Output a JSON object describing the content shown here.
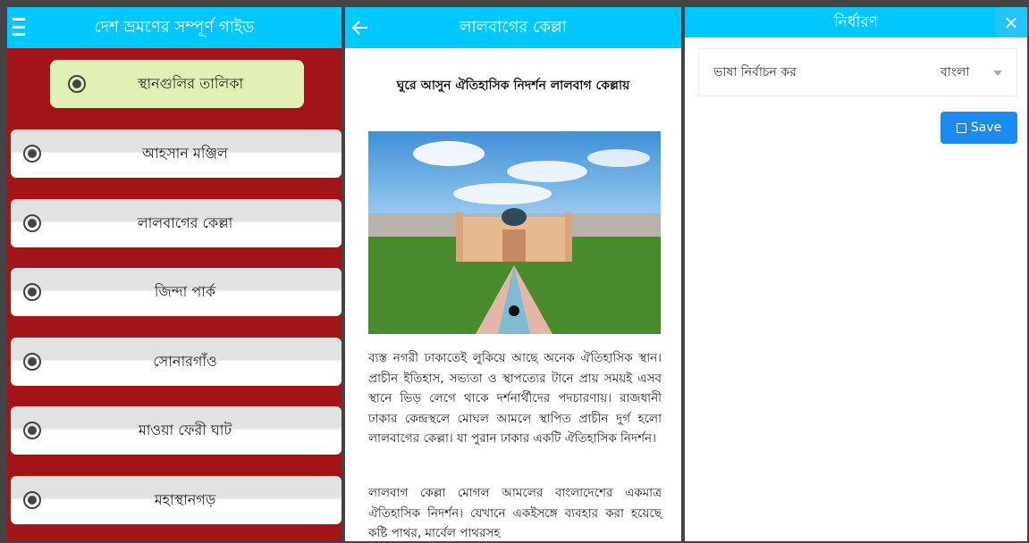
{
  "colors": {
    "appbar": "#00c8ff",
    "list_bg": "#a31418",
    "save_button": "#1c8bf0",
    "header_item": "#e3f0b5"
  },
  "guide": {
    "title": "দেশ ভ্রমণের সম্পূর্ণ গাইড",
    "header_item": "স্থানগুলির তালিকা",
    "items": [
      {
        "label": "আহসান মঞ্জিল"
      },
      {
        "label": "লালবাগের কেল্লা"
      },
      {
        "label": "জিন্দা পার্ক"
      },
      {
        "label": "সোনারগাঁও"
      },
      {
        "label": "মাওয়া ফেরী ঘাট"
      },
      {
        "label": "মহাস্থানগড়"
      }
    ]
  },
  "article": {
    "title": "লালবাগের কেল্লা",
    "heading": "ঘুরে আসুন ঐতিহাসিক নিদর্শন লালবাগ কেল্লায়",
    "image_icon": "fort-photo",
    "paragraph1": "ব্যস্ত নগরী ঢাকাতেই লুকিয়ে আছে অনেক ঐতিহাসিক স্থান। প্রাচীন ইতিহাস, সভ্যতা ও স্থাপত্যের টানে প্রায় সময়ই এসব স্থানে ভিড় লেগে থাকে দর্শনার্থীদের পদচারণায়। রাজধানী ঢাকার কেন্দ্রস্থলে মোঘল আমলে স্থাপিত প্রাচীন দুর্গ হলো লালবাগের কেল্লা। যা পুরান ঢাকার একটি ঐতিহাসিক নিদর্শন।",
    "paragraph2": "লালবাগ কেল্লা মোগল আমলের বাংলাদেশের একমাত্র ঐতিহাসিক নিদর্শন। যেখানে একইসঙ্গে ব্যবহার করা হয়েছে কষ্টি পাথর, মার্বেল পাথরসহ"
  },
  "settings": {
    "title": "নির্ধারণ",
    "close_label": "×",
    "language_label": "ভাষা নির্বাচন কর",
    "language_value": "বাংলা",
    "save_label": "Save"
  }
}
